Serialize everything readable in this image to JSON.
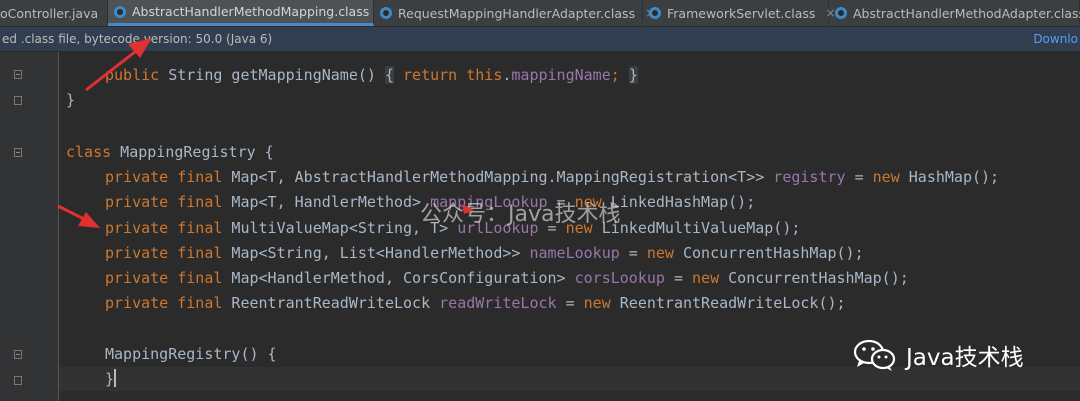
{
  "tabs": [
    {
      "label": "oController.java",
      "active": false
    },
    {
      "label": "AbstractHandlerMethodMapping.class",
      "active": true
    },
    {
      "label": "RequestMappingHandlerAdapter.class",
      "active": false
    },
    {
      "label": "FrameworkServlet.class",
      "active": false
    },
    {
      "label": "AbstractHandlerMethodAdapter.class",
      "active": false
    }
  ],
  "tab_close_glyph": "×",
  "infobar": {
    "message": "ed .class file, bytecode version: 50.0 (Java 6)",
    "link": "Downlo"
  },
  "code": {
    "line_getmapping": {
      "k1": "public",
      "t1": " String getMappingName() ",
      "b1": "{",
      "t2": " ",
      "k2": "return",
      "t3": " ",
      "k3": "this",
      "t4": ".",
      "f1": "mappingName",
      "k4": ";",
      "t5": " ",
      "b2": "}"
    },
    "line_close": {
      "t1": "}"
    },
    "line_class": {
      "k1": "class",
      "t1": " MappingRegistry {"
    },
    "line_registry": {
      "k1": "private final",
      "t1": " Map<T, AbstractHandlerMethodMapping.MappingRegistration<T>> ",
      "f1": "registry",
      "t2": " = ",
      "k2": "new",
      "t3": " HashMap();"
    },
    "line_mappinglookup": {
      "k1": "private final",
      "t1": " Map<T, HandlerMethod> ",
      "f1": "mappingLookup",
      "t2": " = ",
      "k2": "new",
      "t3": " LinkedHashMap();"
    },
    "line_urllookup": {
      "k1": "private final",
      "t1": " MultiValueMap<String, T> ",
      "f1": "urlLookup",
      "t2": " = ",
      "k2": "new",
      "t3": " LinkedMultiValueMap();"
    },
    "line_namelookup": {
      "k1": "private final",
      "t1": " Map<String, List<HandlerMethod>> ",
      "f1": "nameLookup",
      "t2": " = ",
      "k2": "new",
      "t3": " ConcurrentHashMap();"
    },
    "line_corslookup": {
      "k1": "private final",
      "t1": " Map<HandlerMethod, CorsConfiguration> ",
      "f1": "corsLookup",
      "t2": " = ",
      "k2": "new",
      "t3": " ConcurrentHashMap();"
    },
    "line_readwritelock": {
      "k1": "private final",
      "t1": " ReentrantReadWriteLock ",
      "f1": "readWriteLock",
      "t2": " = ",
      "k2": "new",
      "t3": " ReentrantReadWriteLock();"
    },
    "line_ctor": {
      "t1": "MappingRegistry() {"
    },
    "line_ctor_close": {
      "t1": "}"
    }
  },
  "watermark": "公众号：Java技术栈",
  "brand": "Java技术栈",
  "colors": {
    "keyword": "#cc7832",
    "field": "#9876aa",
    "text": "#a9b7c6",
    "annotation_arrow": "#e03030"
  }
}
